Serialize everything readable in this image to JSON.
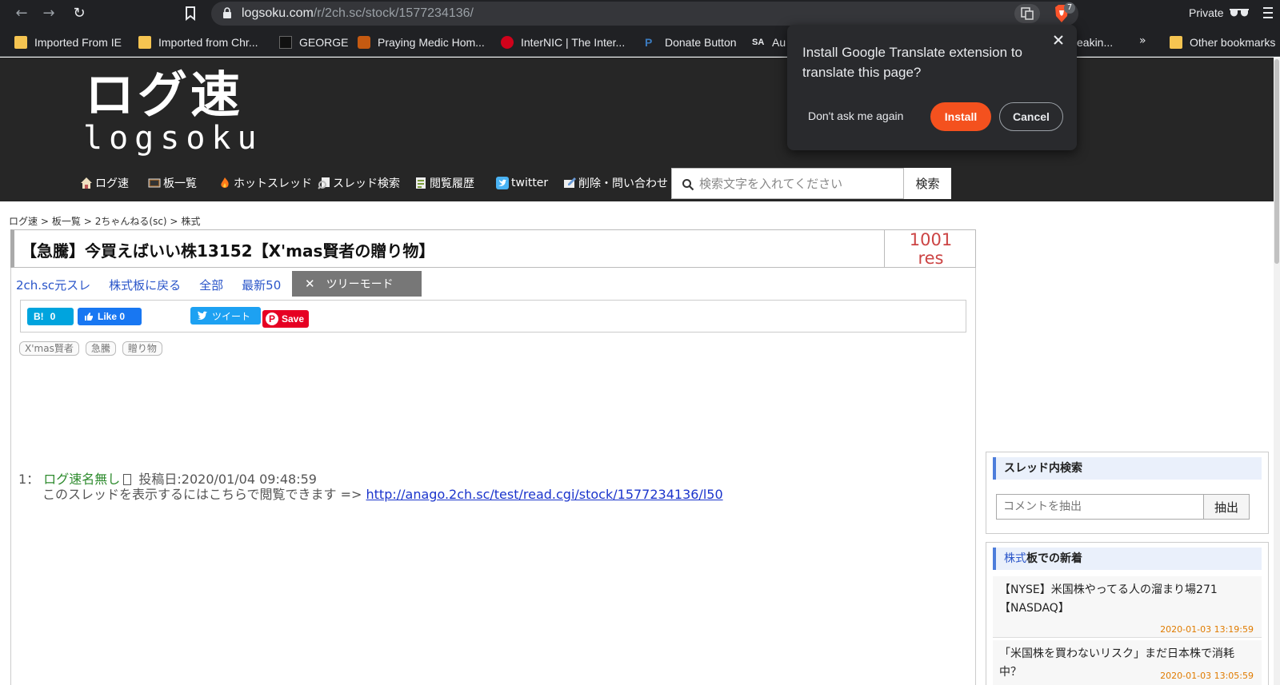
{
  "browser": {
    "url_domain": "logsoku.com",
    "url_path": "/r/2ch.sc/stock/1577234136/",
    "brave_count": "7",
    "private_label": "Private",
    "bookmarks": [
      {
        "label": "Imported From IE",
        "icon": "folder-icon"
      },
      {
        "label": "Imported from Chr...",
        "icon": "folder-icon"
      },
      {
        "label": "GEORGE",
        "icon": "george-icon"
      },
      {
        "label": "Praying Medic Hom...",
        "icon": "praying-medic-icon"
      },
      {
        "label": "InterNIC | The Inter...",
        "icon": "internic-icon"
      },
      {
        "label": "Donate Button",
        "icon": "paypal-icon"
      },
      {
        "label": "Au",
        "icon": "sa-icon"
      },
      {
        "label": "eakin...",
        "icon": "bookmark-icon"
      }
    ],
    "bookmarks_more": "»",
    "other_bookmarks": "Other bookmarks"
  },
  "translate_popup": {
    "message": "Install Google Translate extension to translate this page?",
    "dont_ask": "Don't ask me again",
    "install": "Install",
    "cancel": "Cancel"
  },
  "site": {
    "logo_jp": "ログ速",
    "logo_en": "logsoku",
    "nav": [
      {
        "label": "ログ速",
        "icon": "home-icon"
      },
      {
        "label": "板一覧",
        "icon": "monitor-icon"
      },
      {
        "label": "ホットスレッド",
        "icon": "fire-icon"
      },
      {
        "label": "スレッド検索",
        "icon": "thread-search-icon"
      },
      {
        "label": "閲覧履歴",
        "icon": "history-icon"
      },
      {
        "label": "twitter",
        "icon": "twitter-icon"
      },
      {
        "label": "削除・問い合わせ",
        "icon": "contact-icon"
      }
    ],
    "search_placeholder": "検索文字を入れてください",
    "search_button": "検索"
  },
  "breadcrumb": [
    "ログ速 >",
    "板一覧 >",
    "2ちゃんねる(sc) >",
    "株式"
  ],
  "thread": {
    "title": "【急騰】今買えばいい株13152【X'mas賢者の贈り物】",
    "res_count": "1001",
    "res_label": "res",
    "links": [
      "2ch.sc元スレ",
      "株式板に戻る",
      "全部",
      "最新50"
    ],
    "tree_mode": "ツリーモード",
    "social": {
      "hatena_label": "B!",
      "hatena_count": "0",
      "fb_label": "Like 0",
      "tweet_label": "ツイート",
      "pin_label": "Save"
    },
    "tags": [
      "X'mas賢者",
      "急騰",
      "贈り物"
    ],
    "post": {
      "number": "1：",
      "name": "ログ速名無し",
      "date": "投稿日:2020/01/04 09:48:59",
      "body": "このスレッドを表示するにはこちらで閲覧できます => ",
      "link": "http://anago.2ch.sc/test/read.cgi/stock/1577234136/l50"
    }
  },
  "sidebar": {
    "search_heading": "スレッド内検索",
    "search_placeholder": "コメントを抽出",
    "search_button": "抽出",
    "news_heading_link": "株式",
    "news_heading_rest": "板での新着",
    "news": [
      {
        "title": "【NYSE】米国株やってる人の溜まり場271【NASDAQ】",
        "date": "2020-01-03 13:19:59"
      },
      {
        "title": "「米国株を買わないリスク」まだ日本株で消耗中？",
        "date": "2020-01-03 13:05:59"
      }
    ]
  }
}
